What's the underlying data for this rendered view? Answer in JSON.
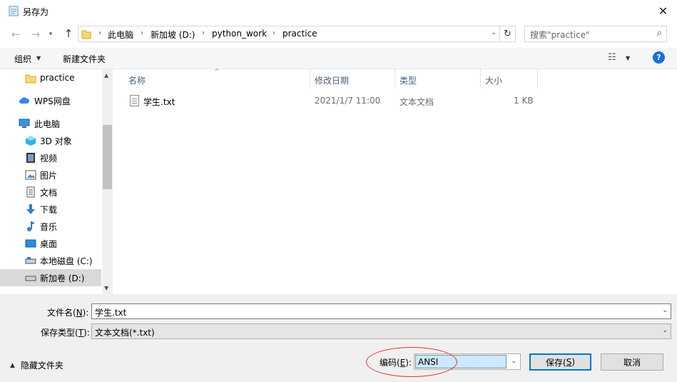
{
  "window": {
    "title": "另存为",
    "close_glyph": "✕"
  },
  "address": {
    "breadcrumbs": [
      "此电脑",
      "新加坡 (D:)",
      "python_work",
      "practice"
    ],
    "search_placeholder": "搜索\"practice\""
  },
  "toolbar": {
    "organize_label": "组织",
    "new_folder_label": "新建文件夹"
  },
  "nav": {
    "items": [
      {
        "label": "practice",
        "icon": "folder-icon"
      },
      {
        "label": "WPS网盘",
        "icon": "cloud-icon"
      },
      {
        "label": "此电脑",
        "icon": "computer-icon"
      },
      {
        "label": "3D 对象",
        "icon": "cube-icon"
      },
      {
        "label": "视频",
        "icon": "video-icon"
      },
      {
        "label": "图片",
        "icon": "picture-icon"
      },
      {
        "label": "文档",
        "icon": "document-icon"
      },
      {
        "label": "下载",
        "icon": "download-icon"
      },
      {
        "label": "音乐",
        "icon": "music-icon"
      },
      {
        "label": "桌面",
        "icon": "desktop-icon"
      },
      {
        "label": "本地磁盘 (C:)",
        "icon": "drive-icon"
      },
      {
        "label": "新加卷 (D:)",
        "icon": "drive-icon"
      }
    ],
    "selected": "新加卷 (D:)"
  },
  "filelist": {
    "columns": [
      "名称",
      "修改日期",
      "类型",
      "大小"
    ],
    "rows": [
      {
        "name": "学生.txt",
        "modified": "2021/1/7 11:00",
        "type": "文本文档",
        "size": "1 KB"
      }
    ]
  },
  "form": {
    "filename_label": "文件名(",
    "filename_key": "N",
    "filename_label_end": "):",
    "filename_value": "学生.txt",
    "filetype_label": "保存类型(",
    "filetype_key": "T",
    "filetype_label_end": "):",
    "filetype_value": "文本文档(*.txt)",
    "hide_folders_label": "隐藏文件夹",
    "encoding_label": "编码(",
    "encoding_key": "E",
    "encoding_label_end": "):",
    "encoding_value": "ANSI",
    "save_label": "保存(",
    "save_key": "S",
    "save_label_end": ")",
    "cancel_label": "取消"
  },
  "colors": {
    "accent": "#0078d7",
    "help_icon": "#1a6fd6",
    "annotation_circle": "#e03030",
    "selection": "#cde8ff"
  }
}
